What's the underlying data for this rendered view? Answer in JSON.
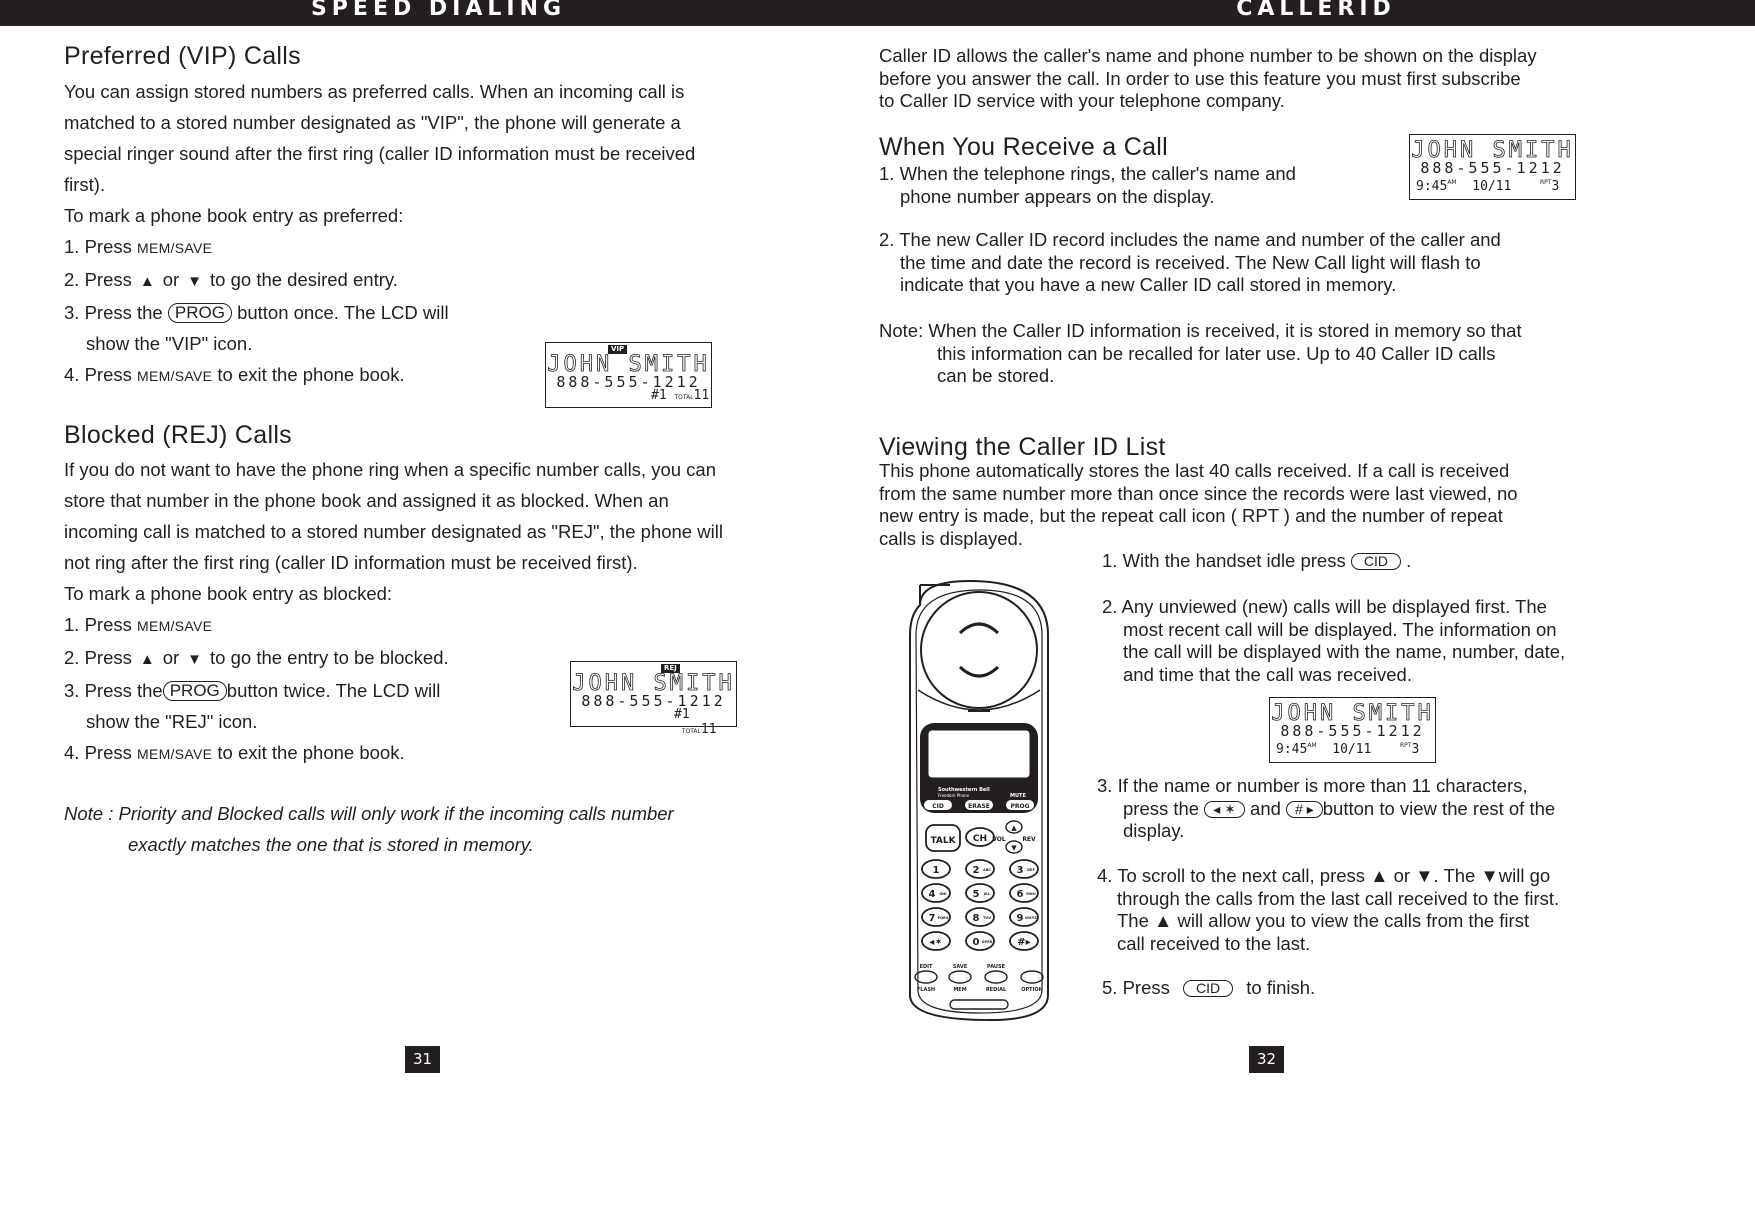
{
  "header": {
    "left_title": "SPEED DIALING",
    "right_title": "CALLERID"
  },
  "left_page": {
    "vip": {
      "heading": "Preferred (VIP) Calls",
      "body": [
        "You can assign stored numbers as preferred calls. When an incoming call is",
        "matched to a stored number designated as \"VIP\",  the phone will generate a",
        "special ringer sound after the first ring (caller ID information must be received",
        "first)."
      ],
      "intro": "To mark a phone book entry as preferred:",
      "step1_prefix": "1. Press ",
      "step1_key": "MEM/SAVE",
      "step2_prefix": "2. Press",
      "step2_or": "or",
      "step2_suffix": "to go the desired entry.",
      "step3_prefix": "3. Press the",
      "step3_key": "PROG",
      "step3_suffix": "button once. The LCD will",
      "step3_cont": "show the  \"VIP\"  icon.",
      "step4_prefix": "4. Press ",
      "step4_key": "MEM/SAVE",
      "step4_suffix": " to exit the phone book.",
      "lcd": {
        "badge": "VIP",
        "name": "JOHN SMITH",
        "number": "888-555-1212",
        "entry": "#1",
        "total_label": "TOTAL",
        "total": "11"
      }
    },
    "rej": {
      "heading": "Blocked (REJ) Calls",
      "body": [
        "If you do not want to have the phone ring when a specific number calls, you can",
        "store that number in the phone book and assigned it as blocked. When an",
        "incoming call is matched to a stored number designated as \"REJ\",  the phone will",
        "not ring after the first ring (caller ID information must be received first)."
      ],
      "intro": "To mark a phone book entry as blocked:",
      "step1_prefix": "1. Press  ",
      "step1_key": "MEM/SAVE",
      "step2_prefix": "2. Press",
      "step2_or": "or",
      "step2_suffix": "to go the entry to be blocked.",
      "step3_prefix": "3. Press the",
      "step3_key": "PROG",
      "step3_suffix": "button twice. The LCD will",
      "step3_cont": "show the  \"REJ\" icon.",
      "step4_prefix": "4. Press  ",
      "step4_key": "MEM/SAVE",
      "step4_suffix": " to exit the phone book.",
      "lcd": {
        "badge": "REJ",
        "name": "JOHN SMITH",
        "number": "888-555-1212",
        "entry": "#1",
        "total_label": "TOTAL",
        "total": "11"
      }
    },
    "note": [
      "Note : Priority and Blocked calls will only  work  if  the  incoming  calls  number",
      "exactly  matches  the one  that  is stored  in memory."
    ],
    "page_number": "31"
  },
  "right_page": {
    "intro": [
      "Caller ID allows the caller's name and phone number to be shown on the display",
      "before you answer the call. In order to use this feature you must first subscribe",
      "to Caller ID service with your telephone company."
    ],
    "receive": {
      "heading": "When You Receive a Call",
      "step1": [
        "1. When the telephone rings, the caller's name and",
        "phone number appears on the display."
      ],
      "step2": [
        "2. The new Caller ID record includes the name and number of the caller and",
        "the time and date the record is received. The New Call light will flash to",
        "indicate that you have a new Caller ID call stored in memory."
      ],
      "note_label": "Note:",
      "note": [
        "When the Caller ID information is received, it is stored in memory so that",
        "this information can be recalled for later use. Up to 40 Caller ID calls",
        "can be stored."
      ],
      "lcd": {
        "name": "JOHN SMITH",
        "number": "888-555-1212",
        "time": "9:45",
        "ampm": "AM",
        "date": "10/11",
        "rpt_label": "RPT",
        "rpt": "3"
      }
    },
    "viewing": {
      "heading": "Viewing the Caller ID List",
      "body": [
        "This phone automatically stores the last 40 calls received. If a call is received",
        "from the same number more than once since the records were last viewed, no",
        "new entry is made, but the repeat call icon ( RPT ) and the number of repeat",
        "calls is displayed."
      ],
      "step1_prefix": "1. With the handset idle press",
      "step1_key": "CID",
      "step1_suffix": ".",
      "step2": [
        "2. Any unviewed (new) calls will be displayed first. The",
        "most recent call will be displayed. The information on",
        "the call will be displayed with the name, number, date,",
        "and time that the call was received."
      ],
      "step3_line1": "3. If the name or number is more than 11 characters,",
      "step3_prefix": "press the",
      "step3_key1": "◂ ✶",
      "step3_and": "and",
      "step3_key2": "# ▸",
      "step3_suffix": "button to view the rest of the",
      "step3_cont": "display.",
      "step4": [
        "4. To scroll to the next call, press   ▲ or   ▼. The   ▼will  go",
        "through the calls from the last call received to the  first.",
        "The  ▲  will allow  you  to  view  the  calls  from  the  first",
        "call received to the last."
      ],
      "step5_prefix": "5. Press",
      "step5_key": "CID",
      "step5_suffix": "to finish.",
      "lcd": {
        "name": "JOHN SMITH",
        "number": "888-555-1212",
        "time": "9:45",
        "ampm": "AM",
        "date": "10/11",
        "rpt_label": "RPT",
        "rpt": "3"
      }
    },
    "phone": {
      "brand": "Southwestern Bell",
      "model": "Freedom Phone",
      "soft_keys": [
        "CID",
        "ERASE",
        "PROG"
      ],
      "mute_label": "MUTE",
      "talk": "TALK",
      "ch": "CH",
      "vol": "VOL",
      "rev": "REV",
      "keys": [
        {
          "d": "1",
          "l": ""
        },
        {
          "d": "2",
          "l": "ABC"
        },
        {
          "d": "3",
          "l": "DEF"
        },
        {
          "d": "4",
          "l": "GHI"
        },
        {
          "d": "5",
          "l": "JKL"
        },
        {
          "d": "6",
          "l": "MNO"
        },
        {
          "d": "7",
          "l": "PQRS"
        },
        {
          "d": "8",
          "l": "TUV"
        },
        {
          "d": "9",
          "l": "WXYZ"
        },
        {
          "d": "◂✶",
          "l": ""
        },
        {
          "d": "0",
          "l": "OPER"
        },
        {
          "d": "#▸",
          "l": ""
        }
      ],
      "top_labels": [
        "EDIT",
        "SAVE",
        "PAUSE",
        ""
      ],
      "bottom_labels": [
        "FLASH",
        "MEM",
        "REDIAL",
        "OPTION"
      ]
    },
    "page_number": "32"
  }
}
